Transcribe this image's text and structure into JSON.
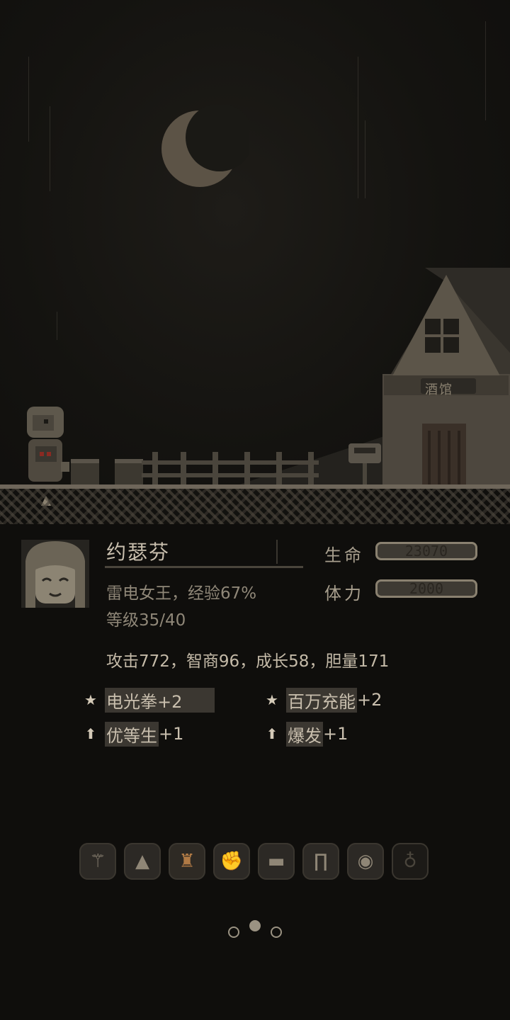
{
  "character": {
    "name": "约瑟芬",
    "title_exp": "雷电女王，经验67%",
    "level": "等级35/40",
    "attributes": "攻击772，智商96，成长58，胆量171"
  },
  "vitals": {
    "hp_label": "生命",
    "hp_value": "23070",
    "stamina_label": "体力",
    "stamina_value": "2000"
  },
  "skills": [
    {
      "name": "电光拳",
      "bonus": "+2",
      "icon": "star-icon"
    },
    {
      "name": "百万充能",
      "bonus": "+2",
      "icon": "star-icon"
    },
    {
      "name": "优等生",
      "bonus": "+1",
      "icon": "arrow-up-icon"
    },
    {
      "name": "爆发",
      "bonus": "+1",
      "icon": "arrow-up-icon"
    }
  ],
  "scene": {
    "tavern_sign": "酒馆"
  },
  "equipment": [
    "staff-icon",
    "hat-icon",
    "armor-icon",
    "gloves-icon",
    "boots-icon",
    "cloak-icon",
    "ring-icon",
    "potion-icon"
  ],
  "pager": {
    "current": 2,
    "total": 3
  }
}
